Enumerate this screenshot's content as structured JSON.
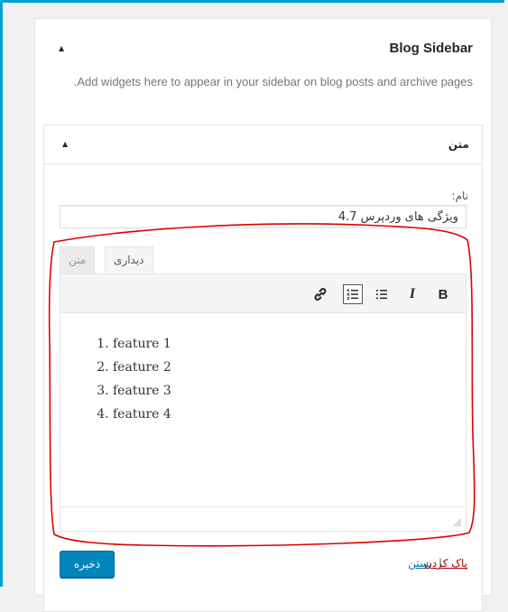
{
  "panel": {
    "title": "Blog Sidebar",
    "description": "Add widgets here to appear in your sidebar on blog posts and archive pages.",
    "toggle": "▲"
  },
  "widget": {
    "title": "متن",
    "toggle": "▲",
    "name_label": "نام:",
    "name_value": "ویژگی های وردپرس 4.7",
    "tabs": {
      "visual": "دیداری",
      "text": "متن"
    },
    "list_items": [
      "feature 1",
      "feature 2",
      "feature 3",
      "feature 4"
    ],
    "actions": {
      "delete": "پاک کردن",
      "separator": "|",
      "close": "بستن",
      "save": "ذخیره"
    }
  },
  "icons": {
    "bold": "bold-icon",
    "italic": "italic-icon",
    "bullets": "bulleted-list-icon",
    "numbered": "numbered-list-icon",
    "link": "link-icon"
  },
  "toolbar_labels": {
    "bold": "B",
    "italic": "I"
  },
  "colors": {
    "accent": "#00a0d2",
    "button": "#0085ba",
    "annotation": "#e00000"
  }
}
